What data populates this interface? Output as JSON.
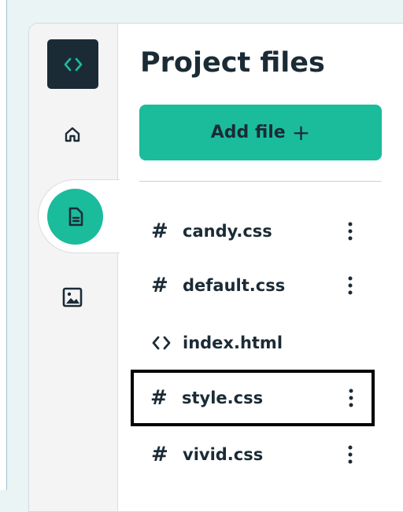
{
  "sidebar": {
    "logo_icon": "code-icon",
    "items": [
      {
        "name": "home",
        "icon": "home-icon"
      },
      {
        "name": "files",
        "icon": "file-icon",
        "active": true
      },
      {
        "name": "images",
        "icon": "image-icon"
      }
    ]
  },
  "header": {
    "title": "Project files"
  },
  "add_button": {
    "label": "Add file",
    "symbol": "+"
  },
  "files": [
    {
      "name": "candy.css",
      "icon_glyph": "#",
      "icon": "hash-icon",
      "has_menu": true
    },
    {
      "name": "default.css",
      "icon_glyph": "#",
      "icon": "hash-icon",
      "has_menu": true
    },
    {
      "name": "index.html",
      "icon_glyph": "<>",
      "icon": "code-icon",
      "has_menu": false
    },
    {
      "name": "style.css",
      "icon_glyph": "#",
      "icon": "hash-icon",
      "has_menu": true,
      "selected": true
    },
    {
      "name": "vivid.css",
      "icon_glyph": "#",
      "icon": "hash-icon",
      "has_menu": true
    }
  ],
  "colors": {
    "accent": "#1abc9c",
    "dark": "#1b2b36",
    "selection_border": "#000000"
  }
}
